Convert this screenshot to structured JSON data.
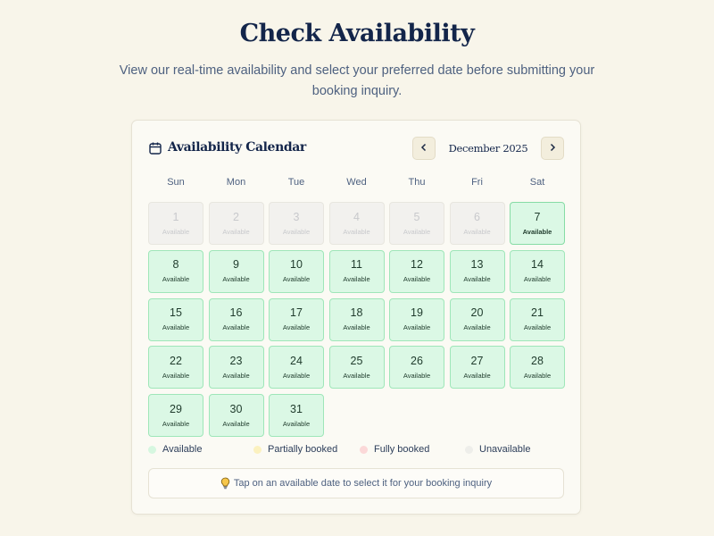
{
  "header": {
    "title": "Check Availability",
    "subtitle": "View our real-time availability and select your preferred date before submitting your booking inquiry."
  },
  "calendar": {
    "title": "Availability Calendar",
    "month_label": "December 2025",
    "prev_icon": "chevron-left-icon",
    "next_icon": "chevron-right-icon",
    "weekdays": [
      "Sun",
      "Mon",
      "Tue",
      "Wed",
      "Thu",
      "Fri",
      "Sat"
    ],
    "days": [
      {
        "num": "1",
        "status": "Available",
        "state": "unavailable"
      },
      {
        "num": "2",
        "status": "Available",
        "state": "unavailable"
      },
      {
        "num": "3",
        "status": "Available",
        "state": "unavailable"
      },
      {
        "num": "4",
        "status": "Available",
        "state": "unavailable"
      },
      {
        "num": "5",
        "status": "Available",
        "state": "unavailable"
      },
      {
        "num": "6",
        "status": "Available",
        "state": "unavailable"
      },
      {
        "num": "7",
        "status": "Available",
        "state": "today"
      },
      {
        "num": "8",
        "status": "Available",
        "state": "available"
      },
      {
        "num": "9",
        "status": "Available",
        "state": "available"
      },
      {
        "num": "10",
        "status": "Available",
        "state": "available"
      },
      {
        "num": "11",
        "status": "Available",
        "state": "available"
      },
      {
        "num": "12",
        "status": "Available",
        "state": "available"
      },
      {
        "num": "13",
        "status": "Available",
        "state": "available"
      },
      {
        "num": "14",
        "status": "Available",
        "state": "available"
      },
      {
        "num": "15",
        "status": "Available",
        "state": "available"
      },
      {
        "num": "16",
        "status": "Available",
        "state": "available"
      },
      {
        "num": "17",
        "status": "Available",
        "state": "available"
      },
      {
        "num": "18",
        "status": "Available",
        "state": "available"
      },
      {
        "num": "19",
        "status": "Available",
        "state": "available"
      },
      {
        "num": "20",
        "status": "Available",
        "state": "available"
      },
      {
        "num": "21",
        "status": "Available",
        "state": "available"
      },
      {
        "num": "22",
        "status": "Available",
        "state": "available"
      },
      {
        "num": "23",
        "status": "Available",
        "state": "available"
      },
      {
        "num": "24",
        "status": "Available",
        "state": "available"
      },
      {
        "num": "25",
        "status": "Available",
        "state": "available"
      },
      {
        "num": "26",
        "status": "Available",
        "state": "available"
      },
      {
        "num": "27",
        "status": "Available",
        "state": "available"
      },
      {
        "num": "28",
        "status": "Available",
        "state": "available"
      },
      {
        "num": "29",
        "status": "Available",
        "state": "available"
      },
      {
        "num": "30",
        "status": "Available",
        "state": "available"
      },
      {
        "num": "31",
        "status": "Available",
        "state": "available"
      }
    ]
  },
  "legend": [
    {
      "label": "Available",
      "color": "#d6f7e0"
    },
    {
      "label": "Partially booked",
      "color": "#fbf1bf"
    },
    {
      "label": "Fully booked",
      "color": "#fbd8d8"
    },
    {
      "label": "Unavailable",
      "color": "#eeeeea"
    }
  ],
  "tip": {
    "icon": "lightbulb-icon",
    "text": "Tap on an available date to select it for your booking inquiry"
  },
  "colors": {
    "background": "#f8f5ea",
    "heading": "#13254a",
    "available_bg": "#dbf8e5",
    "available_border": "#9fe6b9",
    "unavailable_bg": "#f2f1ee"
  }
}
